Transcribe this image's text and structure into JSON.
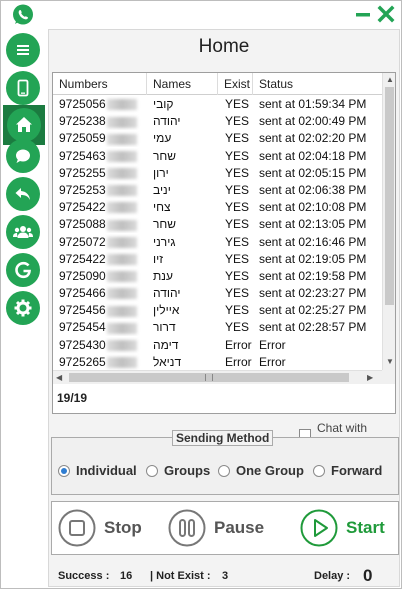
{
  "window": {
    "title": "Home"
  },
  "sidebar": {
    "items": [
      {
        "icon": "menu-icon"
      },
      {
        "icon": "phone-icon"
      },
      {
        "icon": "home-icon"
      },
      {
        "icon": "chat-icon"
      },
      {
        "icon": "reply-icon"
      },
      {
        "icon": "group-icon"
      },
      {
        "icon": "g-icon"
      },
      {
        "icon": "gear-icon"
      }
    ],
    "active": "home-icon"
  },
  "table": {
    "headers": [
      "Numbers",
      "Names",
      "Exist",
      "Status"
    ],
    "rows": [
      {
        "number": "9725056",
        "name": "קובי",
        "exist": "YES",
        "status": "sent at 01:59:34 PM"
      },
      {
        "number": "9725238",
        "name": "יהודה",
        "exist": "YES",
        "status": "sent at 02:00:49 PM"
      },
      {
        "number": "9725059",
        "name": "עמי",
        "exist": "YES",
        "status": "sent at 02:02:20 PM"
      },
      {
        "number": "9725463",
        "name": "שחר",
        "exist": "YES",
        "status": "sent at 02:04:18 PM"
      },
      {
        "number": "9725255",
        "name": "ירון",
        "exist": "YES",
        "status": "sent at 02:05:15 PM"
      },
      {
        "number": "9725253",
        "name": "יניב",
        "exist": "YES",
        "status": "sent at 02:06:38 PM"
      },
      {
        "number": "9725422",
        "name": "צחי",
        "exist": "YES",
        "status": "sent at 02:10:08 PM"
      },
      {
        "number": "9725088",
        "name": "שחר",
        "exist": "YES",
        "status": "sent at 02:13:05 PM"
      },
      {
        "number": "9725072",
        "name": "גירני",
        "exist": "YES",
        "status": "sent at 02:16:46 PM"
      },
      {
        "number": "9725422",
        "name": "זיו",
        "exist": "YES",
        "status": "sent at 02:19:05 PM"
      },
      {
        "number": "9725090",
        "name": "ענת",
        "exist": "YES",
        "status": "sent at 02:19:58 PM"
      },
      {
        "number": "9725466",
        "name": "יהודה",
        "exist": "YES",
        "status": "sent at 02:23:27 PM"
      },
      {
        "number": "9725456",
        "name": "איילין",
        "exist": "YES",
        "status": "sent at 02:25:27 PM"
      },
      {
        "number": "9725454",
        "name": "דרור",
        "exist": "YES",
        "status": "sent at 02:28:57 PM"
      },
      {
        "number": "9725430",
        "name": "דימה",
        "exist": "Error",
        "status": "Error"
      },
      {
        "number": "9725265",
        "name": "דניאל",
        "exist": "Error",
        "status": "Error"
      }
    ],
    "counter": "19/19"
  },
  "chat_with_cloud": {
    "label": "Chat with cloud",
    "checked": false
  },
  "sending_method": {
    "legend": "Sending Method",
    "options": [
      "Individual",
      "Groups",
      "One Group",
      "Forward"
    ],
    "selected": "Individual"
  },
  "actions": {
    "stop": "Stop",
    "pause": "Pause",
    "start": "Start"
  },
  "footer": {
    "success_label": "Success :",
    "success_value": "16",
    "not_exist_label": "| Not Exist :",
    "not_exist_value": "3",
    "delay_label": "Delay :",
    "delay_value": "0"
  },
  "colors": {
    "brand": "#23a455",
    "brand_dark": "#1b7b40",
    "start": "#1f9a3a",
    "radio": "#2f7dd1"
  }
}
